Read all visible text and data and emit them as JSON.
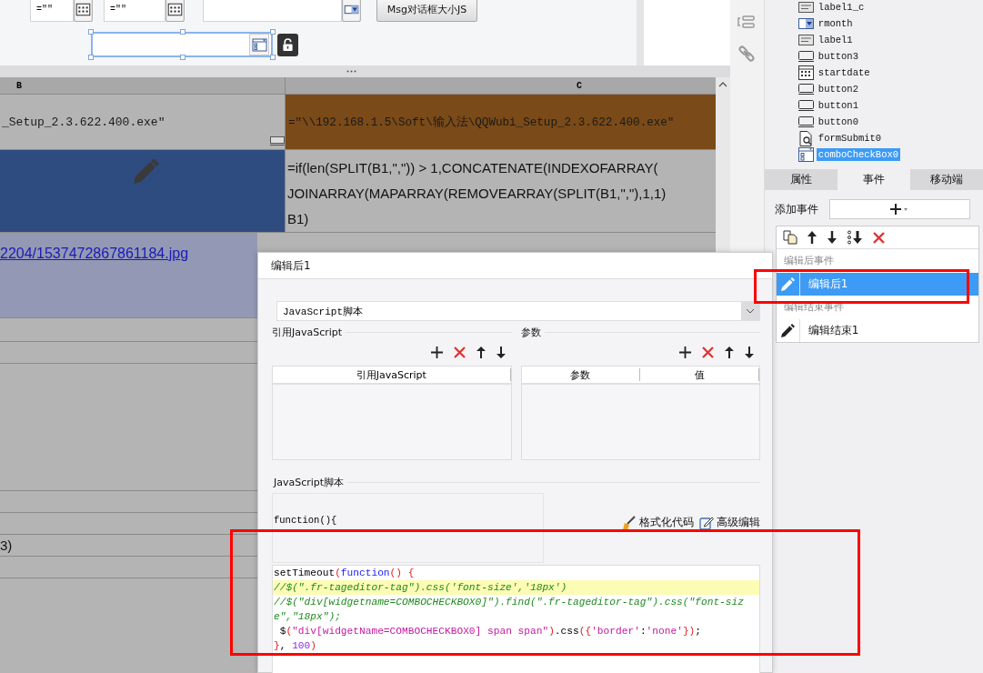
{
  "form": {
    "widgets": [
      {
        "kind": "date",
        "value": "=\"\""
      },
      {
        "kind": "date",
        "value": "=\"\""
      },
      {
        "kind": "combo"
      }
    ],
    "button": "Msg对话框大小JS",
    "selected_widget": {
      "kind": "combocheck",
      "selected": true,
      "locked": false
    }
  },
  "sheet": {
    "columns": [
      {
        "label": "B"
      },
      {
        "label": "C"
      }
    ],
    "rows": [
      {
        "cells": [
          {
            "kind": "text",
            "lines": [
              "_Setup_2.3.622.400.exe\""
            ],
            "color": "#b4b4b4"
          },
          {
            "kind": "text",
            "lines": [
              "=\"\\\\192.168.1.5\\Soft\\输入法\\QQWubi_Setup_2.3.622.400.exe\""
            ],
            "color": "#7a4a18"
          }
        ]
      },
      {
        "cells": [
          {
            "kind": "pencil",
            "color": "#2f4c80"
          },
          {
            "kind": "formula",
            "lines": [
              "=if(len(SPLIT(B1,\",\")) > 1,CONCATENATE(INDEXOFARRAY(",
              "JOINARRAY(MAPARRAY(REMOVEARRAY(SPLIT(B1,\",\"),1,1)",
              "B1)"
            ],
            "color": "#b4b4b4"
          }
        ]
      },
      {
        "cells": [
          {
            "kind": "link",
            "lines": [
              "2204/1537472867861184.jpg"
            ],
            "color": "#9399b4"
          }
        ]
      }
    ],
    "tail_text": "3)"
  },
  "panel": {
    "tree": [
      {
        "label": "label1_c",
        "kind": "label",
        "selected": false
      },
      {
        "label": "rmonth",
        "kind": "combo",
        "selected": false
      },
      {
        "label": "label1",
        "kind": "label",
        "selected": false
      },
      {
        "label": "button3",
        "kind": "button",
        "selected": false
      },
      {
        "label": "startdate",
        "kind": "date",
        "selected": false
      },
      {
        "label": "button2",
        "kind": "button",
        "selected": false
      },
      {
        "label": "button1",
        "kind": "button",
        "selected": false
      },
      {
        "label": "button0",
        "kind": "button",
        "selected": false
      },
      {
        "label": "formSubmit0",
        "kind": "submit",
        "selected": false
      },
      {
        "label": "comboCheckBox0",
        "kind": "combocheck",
        "selected": true
      }
    ],
    "tabs": [
      {
        "label": "属性",
        "selected": false
      },
      {
        "label": "事件",
        "selected": true
      },
      {
        "label": "移动端",
        "selected": false
      }
    ],
    "add_event_label": "添加事件",
    "event_groups": [
      {
        "header": "编辑后事件",
        "items": [
          {
            "label": "编辑后1",
            "selected": true
          }
        ]
      },
      {
        "header": "编辑结束事件",
        "items": [
          {
            "label": "编辑结束1",
            "selected": false
          }
        ]
      }
    ]
  },
  "dialog": {
    "title": "编辑后1",
    "type_select": "JavaScript脚本",
    "sections": [
      {
        "title": "引用JavaScript",
        "columns": [
          "引用JavaScript"
        ]
      },
      {
        "title": "参数",
        "columns": [
          "参数",
          "值"
        ]
      }
    ],
    "script_label": "JavaScript脚本",
    "signature": "function(){",
    "tools": [
      {
        "kind": "format",
        "label": "格式化代码"
      },
      {
        "kind": "edit",
        "label": "高级编辑"
      }
    ],
    "code": [
      {
        "highlighted": false,
        "parts": [
          {
            "kind": "plain",
            "text": "setTimeout"
          },
          {
            "kind": "paren",
            "text": "("
          },
          {
            "kind": "keyword",
            "text": "function"
          },
          {
            "kind": "paren",
            "text": "() {"
          }
        ]
      },
      {
        "highlighted": true,
        "parts": [
          {
            "kind": "comment",
            "text": "//$(\".fr-tageditor-tag\").css('font-size','18px')"
          }
        ]
      },
      {
        "highlighted": false,
        "parts": [
          {
            "kind": "comment",
            "text": "//$(\"div[widgetname=COMBOCHECKBOX0]\").find(\".fr-tageditor-tag\").css(\"font-size\",\"18px\");"
          }
        ]
      },
      {
        "highlighted": false,
        "parts": [
          {
            "kind": "plain",
            "text": " $"
          },
          {
            "kind": "paren",
            "text": "("
          },
          {
            "kind": "string",
            "text": "\"div[widgetName=COMBOCHECKBOX0] span span\""
          },
          {
            "kind": "paren",
            "text": ")"
          },
          {
            "kind": "plain",
            "text": ".css"
          },
          {
            "kind": "paren",
            "text": "({"
          },
          {
            "kind": "string",
            "text": "'border'"
          },
          {
            "kind": "plain",
            "text": ":"
          },
          {
            "kind": "string",
            "text": "'none'"
          },
          {
            "kind": "paren",
            "text": "})"
          },
          {
            "kind": "plain",
            "text": ";"
          }
        ]
      },
      {
        "highlighted": false,
        "parts": [
          {
            "kind": "paren",
            "text": "}"
          },
          {
            "kind": "plain",
            "text": ", "
          },
          {
            "kind": "number",
            "text": "100"
          },
          {
            "kind": "paren",
            "text": ")"
          }
        ]
      }
    ]
  }
}
